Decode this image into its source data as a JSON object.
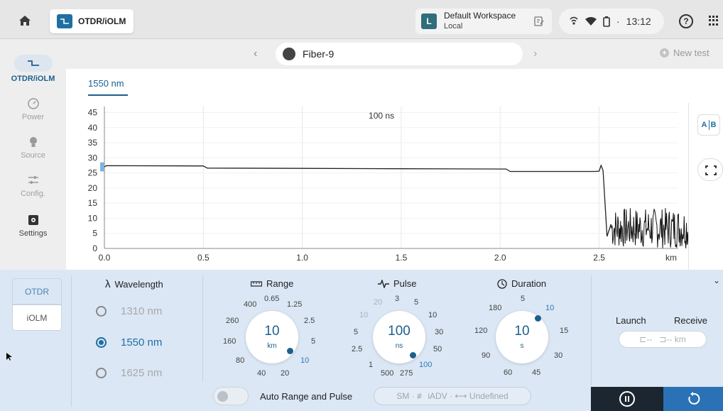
{
  "topbar": {
    "app_tab_label": "OTDR/iOLM",
    "workspace_badge": "L",
    "workspace_name": "Default Workspace",
    "workspace_sub": "Local",
    "time": "13:12",
    "status_sep": "·",
    "help": "?"
  },
  "sidebar": {
    "items": [
      {
        "label": "OTDR/iOLM",
        "icon": "trace-icon"
      },
      {
        "label": "Power",
        "icon": "gauge-icon"
      },
      {
        "label": "Source",
        "icon": "bulb-icon"
      },
      {
        "label": "Config.",
        "icon": "sliders-icon"
      },
      {
        "label": "Settings",
        "icon": "gear-icon"
      }
    ]
  },
  "header": {
    "fiber_name": "Fiber-9",
    "new_test": "New test"
  },
  "wavelength_tab": "1550 nm",
  "chart_data": {
    "type": "line",
    "annotation": "100 ns",
    "xlabel": "km",
    "x_ticks": [
      "0.0",
      "0.5",
      "1.0",
      "1.5",
      "2.0",
      "2.5"
    ],
    "y_ticks": [
      "0",
      "5",
      "10",
      "15",
      "20",
      "25",
      "30",
      "35",
      "40",
      "45"
    ],
    "xlim": [
      0,
      2.9
    ],
    "ylim": [
      0,
      47
    ],
    "grid": true,
    "series": [
      {
        "x": [
          0.0,
          0.01,
          0.5,
          0.52,
          1.0,
          1.5,
          2.03,
          2.05,
          2.48,
          2.5,
          2.51,
          2.52,
          2.53,
          2.54,
          2.56
        ],
        "y": [
          27.0,
          27.4,
          27.3,
          26.6,
          26.5,
          26.4,
          26.3,
          25.5,
          25.5,
          25.6,
          27.5,
          25.8,
          15.0,
          4.0,
          8.0
        ]
      }
    ],
    "noise_floor": {
      "x_start": 2.56,
      "x_end": 2.99,
      "y_min": 0,
      "y_max": 13.5
    }
  },
  "tools": {
    "ab_label_a": "A",
    "ab_label_b": "B"
  },
  "bottom": {
    "mode_otdr": "OTDR",
    "mode_iolm": "iOLM",
    "wavelength_title": "Wavelength",
    "wavelength_symbol": "λ",
    "wavelengths": [
      {
        "label": "1310 nm",
        "selected": false
      },
      {
        "label": "1550 nm",
        "selected": true
      },
      {
        "label": "1625 nm",
        "selected": false
      }
    ],
    "range": {
      "title": "Range",
      "value": "10",
      "unit": "km",
      "ticks": [
        "0.65",
        "1.25",
        "400",
        "2.5",
        "260",
        "5",
        "160",
        "10",
        "80",
        "40",
        "20"
      ]
    },
    "pulse": {
      "title": "Pulse",
      "value": "100",
      "unit": "ns",
      "ticks": [
        "20",
        "3",
        "5",
        "10",
        "10",
        "5",
        "30",
        "2.5",
        "50",
        "1",
        "100",
        "500",
        "275"
      ]
    },
    "duration": {
      "title": "Duration",
      "value": "10",
      "unit": "s",
      "ticks": [
        "5",
        "180",
        "10",
        "120",
        "15",
        "90",
        "30",
        "60",
        "45"
      ]
    },
    "auto_label": "Auto Range and Pulse",
    "setup_text": "SM · ≢ iADV · ⟷ Undefined",
    "launch_label": "Launch",
    "receive_label": "Receive",
    "launch_value": "⊏--",
    "receive_value": "⊐-- km"
  }
}
